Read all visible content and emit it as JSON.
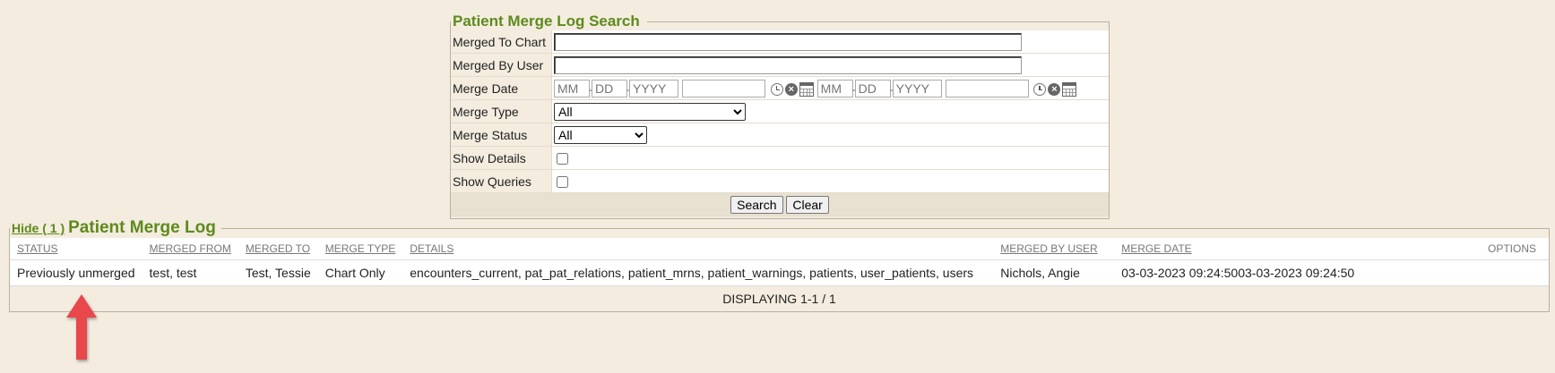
{
  "search": {
    "title": "Patient Merge Log Search",
    "labels": {
      "merged_to_chart": "Merged To Chart",
      "merged_by_user": "Merged By User",
      "merge_date": "Merge Date",
      "merge_type": "Merge Type",
      "merge_status": "Merge Status",
      "show_details": "Show Details",
      "show_queries": "Show Queries"
    },
    "values": {
      "merged_to_chart": "",
      "merged_by_user": "",
      "merge_type": "All",
      "merge_status": "All",
      "show_details": false,
      "show_queries": false
    },
    "date_placeholders": {
      "mm": "MM",
      "dd": "DD",
      "yyyy": "YYYY",
      "time": ""
    },
    "buttons": {
      "search": "Search",
      "clear": "Clear"
    }
  },
  "log": {
    "hide_link": "Hide ( 1 )",
    "title": "Patient Merge Log",
    "columns": {
      "status": "STATUS",
      "merged_from": "MERGED FROM",
      "merged_to": "MERGED TO",
      "merge_type": "MERGE TYPE",
      "details": "DETAILS",
      "merged_by_user": "MERGED BY USER",
      "merge_date": "MERGE DATE",
      "options": "OPTIONS"
    },
    "rows": [
      {
        "status": "Previously unmerged",
        "merged_from": "test, test",
        "merged_to": "Test, Tessie",
        "merge_type": "Chart Only",
        "details": "encounters_current, pat_pat_relations, patient_mrns, patient_warnings, patients, user_patients, users",
        "merged_by_user": "Nichols, Angie",
        "merge_date": "03-03-2023 09:24:5003-03-2023 09:24:50",
        "options": ""
      }
    ],
    "footer": "DISPLAYING 1-1 / 1"
  },
  "colors": {
    "accent": "#5e8a1c",
    "background": "#f3ecdf",
    "arrow": "#e8464b"
  },
  "icons": [
    "clock-icon",
    "clear-icon",
    "calendar-icon",
    "arrow-up-icon"
  ]
}
